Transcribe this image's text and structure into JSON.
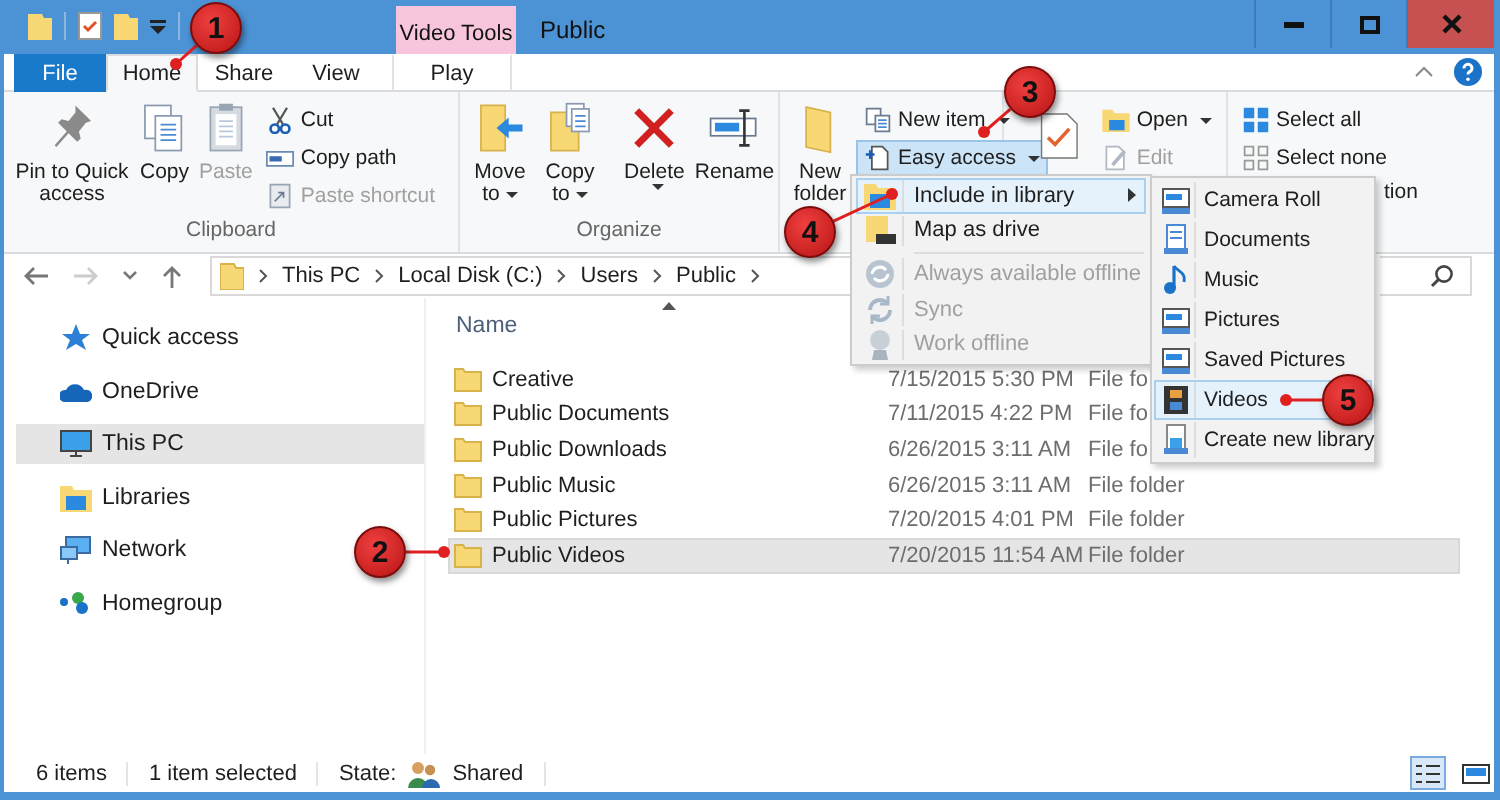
{
  "title_bar": {
    "contextual_group": "Video Tools",
    "title": "Public"
  },
  "tabs": [
    {
      "label": "File",
      "kind": "file",
      "selected": false
    },
    {
      "label": "Home",
      "kind": "tab",
      "selected": true
    },
    {
      "label": "Share",
      "kind": "tab",
      "selected": false
    },
    {
      "label": "View",
      "kind": "tab",
      "selected": false
    },
    {
      "label": "Play",
      "kind": "contextual",
      "selected": false
    }
  ],
  "ribbon": {
    "clipboard": {
      "label": "Clipboard",
      "pin": {
        "label": "Pin to Quick access",
        "disabled": false
      },
      "copy": {
        "label": "Copy",
        "disabled": false
      },
      "paste": {
        "label": "Paste",
        "disabled": true
      },
      "cut": {
        "label": "Cut",
        "disabled": false
      },
      "copy_path": {
        "label": "Copy path",
        "disabled": false
      },
      "paste_shortcut": {
        "label": "Paste shortcut",
        "disabled": true
      }
    },
    "organize": {
      "label": "Organize",
      "move_to": {
        "label": "Move to"
      },
      "copy_to": {
        "label": "Copy to"
      },
      "delete": {
        "label": "Delete"
      },
      "rename": {
        "label": "Rename"
      }
    },
    "new": {
      "new_folder": {
        "label": "New folder"
      },
      "new_item": {
        "label": "New item"
      },
      "easy_access": {
        "label": "Easy access",
        "pressed": true
      }
    },
    "open": {
      "open": {
        "label": "Open",
        "disabled": false
      },
      "edit": {
        "label": "Edit",
        "disabled": true
      }
    },
    "select": {
      "select_all": {
        "label": "Select all"
      },
      "select_none": {
        "label": "Select none"
      },
      "invert_selection_visible": "tion"
    }
  },
  "address": {
    "path": [
      "This PC",
      "Local Disk (C:)",
      "Users",
      "Public"
    ]
  },
  "navigation": [
    {
      "label": "Quick access",
      "selected": false
    },
    {
      "label": "OneDrive",
      "selected": false
    },
    {
      "label": "This PC",
      "selected": true
    },
    {
      "label": "Libraries",
      "selected": false
    },
    {
      "label": "Network",
      "selected": false
    },
    {
      "label": "Homegroup",
      "selected": false
    }
  ],
  "file_list": {
    "columns": [
      "Name"
    ],
    "rows": [
      {
        "name": "Creative",
        "date": "7/15/2015 5:30 PM",
        "type": "File fo",
        "selected": false
      },
      {
        "name": "Public Documents",
        "date": "7/11/2015 4:22 PM",
        "type": "File fo",
        "selected": false
      },
      {
        "name": "Public Downloads",
        "date": "6/26/2015 3:11 AM",
        "type": "File fo",
        "selected": false
      },
      {
        "name": "Public Music",
        "date": "6/26/2015 3:11 AM",
        "type": "File folder",
        "selected": false
      },
      {
        "name": "Public Pictures",
        "date": "7/20/2015 4:01 PM",
        "type": "File folder",
        "selected": false
      },
      {
        "name": "Public Videos",
        "date": "7/20/2015 11:54 AM",
        "type": "File folder",
        "selected": true
      }
    ]
  },
  "easy_access_menu": [
    {
      "label": "Include in library",
      "disabled": false,
      "selected": true,
      "submenu": true,
      "separator_before": false
    },
    {
      "label": "Map as drive",
      "disabled": false,
      "selected": false,
      "submenu": false,
      "separator_before": false
    },
    {
      "label": "Always available offline",
      "disabled": true,
      "selected": false,
      "submenu": false,
      "separator_before": true
    },
    {
      "label": "Sync",
      "disabled": true,
      "selected": false,
      "submenu": false,
      "separator_before": false
    },
    {
      "label": "Work offline",
      "disabled": true,
      "selected": false,
      "submenu": false,
      "separator_before": false
    }
  ],
  "library_submenu": [
    {
      "label": "Camera Roll",
      "selected": false
    },
    {
      "label": "Documents",
      "selected": false
    },
    {
      "label": "Music",
      "selected": false
    },
    {
      "label": "Pictures",
      "selected": false
    },
    {
      "label": "Saved Pictures",
      "selected": false
    },
    {
      "label": "Videos",
      "selected": true
    },
    {
      "label": "Create new library",
      "selected": false
    }
  ],
  "status_bar": {
    "item_count": "6 items",
    "selection": "1 item selected",
    "state_label": "State:",
    "state_value": "Shared",
    "views": [
      {
        "selected": true
      },
      {
        "selected": false
      }
    ]
  },
  "callouts": [
    "1",
    "2",
    "3",
    "4",
    "5"
  ]
}
